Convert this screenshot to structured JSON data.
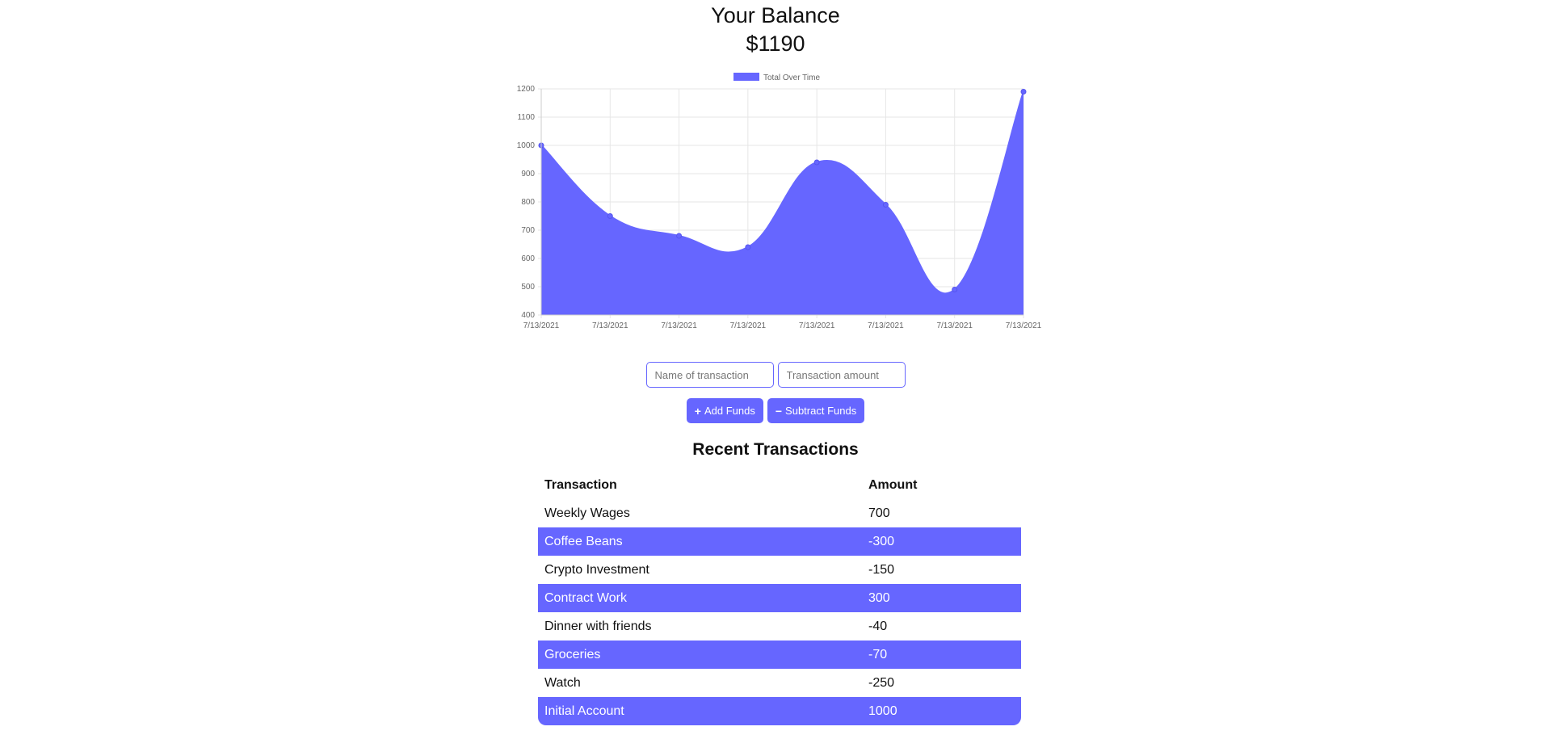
{
  "balance": {
    "title": "Your Balance",
    "amount": "$1190"
  },
  "chart_data": {
    "type": "area",
    "legend": [
      "Total Over Time"
    ],
    "legend_position": "top",
    "categories": [
      "7/13/2021",
      "7/13/2021",
      "7/13/2021",
      "7/13/2021",
      "7/13/2021",
      "7/13/2021",
      "7/13/2021",
      "7/13/2021"
    ],
    "series": [
      {
        "name": "Total Over Time",
        "values": [
          1000,
          750,
          680,
          640,
          940,
          790,
          490,
          1190
        ]
      }
    ],
    "ylim": [
      400,
      1200
    ],
    "yticks": [
      400,
      500,
      600,
      700,
      800,
      900,
      1000,
      1100,
      1200
    ],
    "grid": true,
    "color": "#6666ff"
  },
  "form": {
    "name_placeholder": "Name of transaction",
    "amount_placeholder": "Transaction amount",
    "add_label": "Add Funds",
    "add_icon": "plus-icon",
    "subtract_label": "Subtract Funds",
    "subtract_icon": "minus-icon"
  },
  "transactions": {
    "title": "Recent Transactions",
    "headers": [
      "Transaction",
      "Amount"
    ],
    "rows": [
      {
        "name": "Weekly Wages",
        "amount": "700"
      },
      {
        "name": "Coffee Beans",
        "amount": "-300"
      },
      {
        "name": "Crypto Investment",
        "amount": "-150"
      },
      {
        "name": "Contract Work",
        "amount": "300"
      },
      {
        "name": "Dinner with friends",
        "amount": "-40"
      },
      {
        "name": "Groceries",
        "amount": "-70"
      },
      {
        "name": "Watch",
        "amount": "-250"
      },
      {
        "name": "Initial Account",
        "amount": "1000"
      }
    ]
  },
  "colors": {
    "accent": "#6666ff"
  }
}
